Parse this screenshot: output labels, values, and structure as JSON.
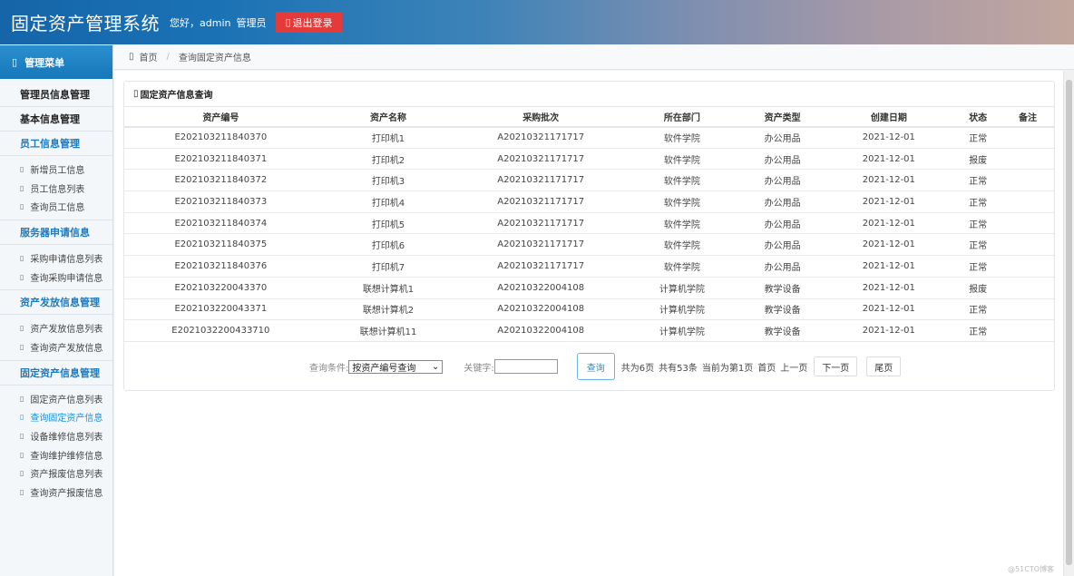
{
  "header": {
    "brand": "固定资产管理系统",
    "greeting": "您好，admin",
    "role": "管理员",
    "logout_label": "退出登录",
    "logout_color": "#e53a3a"
  },
  "sidebar": {
    "title": "管理菜单",
    "groups": [
      {
        "title": "管理员信息管理"
      },
      {
        "title": "基本信息管理"
      },
      {
        "title": "员工信息管理",
        "items": [
          "新增员工信息",
          "员工信息列表",
          "查询员工信息"
        ]
      },
      {
        "title": "服务器申请信息",
        "items": [
          "采购申请信息列表",
          "查询采购申请信息"
        ]
      },
      {
        "title": "资产发放信息管理",
        "items": [
          "资产发放信息列表",
          "查询资产发放信息"
        ]
      },
      {
        "title": "固定资产信息管理",
        "items": [
          "固定资产信息列表",
          "查询固定资产信息",
          "设备维修信息列表",
          "查询维护维修信息",
          "资产报废信息列表",
          "查询资产报废信息"
        ]
      }
    ],
    "active_item": "查询固定资产信息"
  },
  "breadcrumb": {
    "home": "首页",
    "separator": "/",
    "current": "查询固定资产信息"
  },
  "panel": {
    "title": "固定资产信息查询",
    "columns": [
      "资产编号",
      "资产名称",
      "采购批次",
      "所在部门",
      "资产类型",
      "创建日期",
      "状态",
      "备注"
    ],
    "rows": [
      [
        "E202103211840370",
        "打印机1",
        "A20210321171717",
        "软件学院",
        "办公用品",
        "2021-12-01",
        "正常",
        ""
      ],
      [
        "E202103211840371",
        "打印机2",
        "A20210321171717",
        "软件学院",
        "办公用品",
        "2021-12-01",
        "报废",
        ""
      ],
      [
        "E202103211840372",
        "打印机3",
        "A20210321171717",
        "软件学院",
        "办公用品",
        "2021-12-01",
        "正常",
        ""
      ],
      [
        "E202103211840373",
        "打印机4",
        "A20210321171717",
        "软件学院",
        "办公用品",
        "2021-12-01",
        "正常",
        ""
      ],
      [
        "E202103211840374",
        "打印机5",
        "A20210321171717",
        "软件学院",
        "办公用品",
        "2021-12-01",
        "正常",
        ""
      ],
      [
        "E202103211840375",
        "打印机6",
        "A20210321171717",
        "软件学院",
        "办公用品",
        "2021-12-01",
        "正常",
        ""
      ],
      [
        "E202103211840376",
        "打印机7",
        "A20210321171717",
        "软件学院",
        "办公用品",
        "2021-12-01",
        "正常",
        ""
      ],
      [
        "E202103220043370",
        "联想计算机1",
        "A20210322004108",
        "计算机学院",
        "教学设备",
        "2021-12-01",
        "报废",
        ""
      ],
      [
        "E202103220043371",
        "联想计算机2",
        "A20210322004108",
        "计算机学院",
        "教学设备",
        "2021-12-01",
        "正常",
        ""
      ],
      [
        "E2021032200433710",
        "联想计算机11",
        "A20210322004108",
        "计算机学院",
        "教学设备",
        "2021-12-01",
        "正常",
        ""
      ]
    ]
  },
  "pager": {
    "condition_label": "查询条件:",
    "condition_value": "按资产编号查询",
    "keyword_label": "关键字:",
    "keyword_value": "",
    "query_label": "查询",
    "total_pages": "共为6页",
    "total_records": "共有53条",
    "current_page": "当前为第1页",
    "first_label": "首页",
    "prev_label": "上一页",
    "next_label": "下一页",
    "last_label": "尾页"
  },
  "watermark": "@51CTO博客"
}
